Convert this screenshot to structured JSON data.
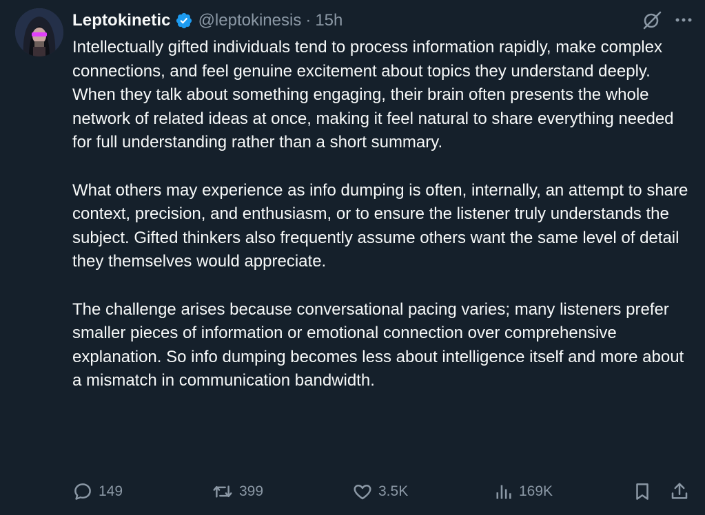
{
  "author": {
    "display_name": "Leptokinetic",
    "handle": "@leptokinesis",
    "separator": "·",
    "time": "15h",
    "verified": true,
    "avatar_icon": "avatar-hooded-figure"
  },
  "tweet": {
    "paragraphs": [
      "Intellectually gifted individuals tend to process information rapidly, make complex connections, and feel genuine excitement about topics they understand deeply. When they talk about something engaging, their brain often presents the whole network of related ideas at once, making it feel natural to share everything needed for full understanding rather than a short summary.",
      "What others may experience as info dumping is often, internally, an attempt to share context, precision, and enthusiasm, or to ensure the listener truly understands the subject. Gifted thinkers also frequently assume others want the same level of detail they themselves would appreciate.",
      "The challenge arises because conversational pacing varies; many listeners prefer smaller pieces of information or emotional connection over comprehensive explanation. So info dumping becomes less about intelligence itself and more about a mismatch in communication bandwidth."
    ]
  },
  "header_icons": [
    "grok-icon",
    "more-icon"
  ],
  "actions": {
    "replies": "149",
    "reposts": "399",
    "likes": "3.5K",
    "views": "169K"
  },
  "colors": {
    "background": "#15202b",
    "text": "#f7f9f9",
    "muted": "#8b98a5",
    "verified": "#1d9bf0"
  }
}
